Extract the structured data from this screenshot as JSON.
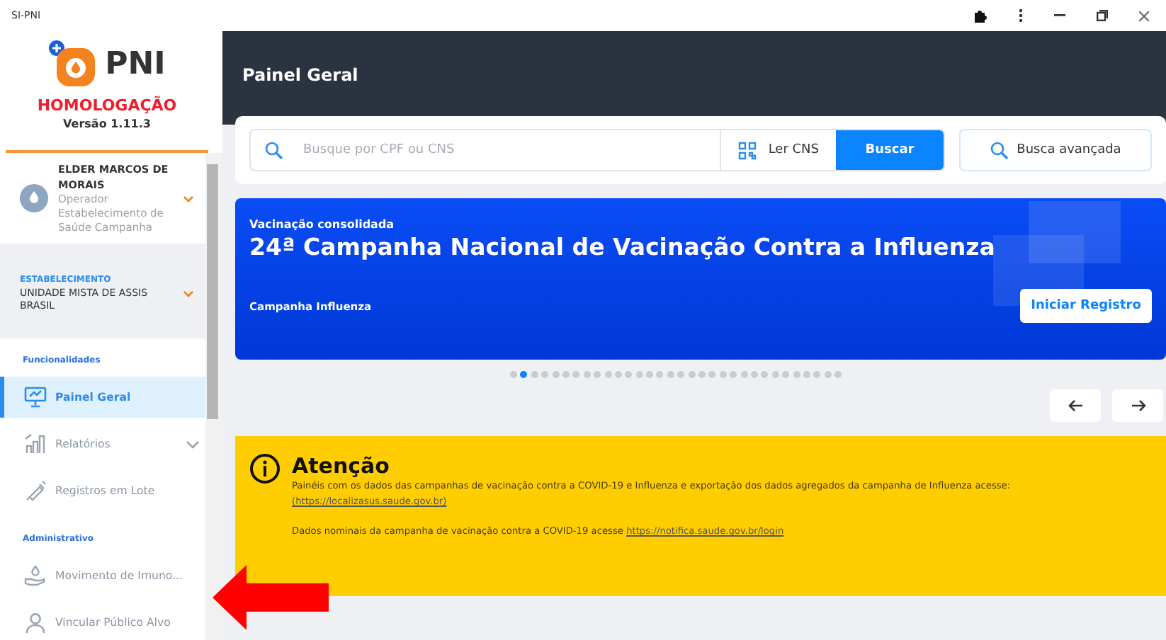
{
  "window": {
    "title": "SI-PNI"
  },
  "sidebar": {
    "logo_text": "PNI",
    "environment": "HOMOLOGAÇÃO",
    "version": "Versão 1.11.3",
    "user": {
      "name": "ELDER MARCOS DE MORAIS",
      "role": "Operador Estabelecimento de Saúde Campanha"
    },
    "establishment": {
      "label": "ESTABELECIMENTO",
      "value": "UNIDADE MISTA DE ASSIS BRASIL"
    },
    "sections": [
      {
        "title": "Funcionalidades",
        "items": [
          {
            "label": "Painel Geral",
            "kind": "panel",
            "selected": true,
            "expandable": false
          },
          {
            "label": "Relatórios",
            "kind": "chart",
            "selected": false,
            "expandable": true
          },
          {
            "label": "Registros em Lote",
            "kind": "syringe",
            "selected": false,
            "expandable": false
          }
        ]
      },
      {
        "title": "Administrativo",
        "items": [
          {
            "label": "Movimento de Imuno...",
            "kind": "hand",
            "selected": false,
            "expandable": false
          },
          {
            "label": "Vincular Público Alvo",
            "kind": "person",
            "selected": false,
            "expandable": false
          }
        ]
      }
    ]
  },
  "header": {
    "title": "Painel Geral"
  },
  "search": {
    "placeholder": "Busque por CPF ou CNS",
    "scan_button": "Ler CNS",
    "search_button": "Buscar",
    "advanced_button": "Busca avançada"
  },
  "banner": {
    "eyebrow": "Vacinação consolidada",
    "title": "24ª Campanha Nacional de Vacinação Contra a Influenza",
    "subtitle": "Campanha Influenza",
    "button": "Iniciar Registro"
  },
  "carousel_dots": [
    {
      "selected": false
    },
    {
      "selected": true
    },
    {
      "selected": false
    },
    {
      "selected": false
    },
    {
      "selected": false
    },
    {
      "selected": false
    },
    {
      "selected": false
    },
    {
      "selected": false
    },
    {
      "selected": false
    },
    {
      "selected": false
    },
    {
      "selected": false
    },
    {
      "selected": false
    },
    {
      "selected": false
    },
    {
      "selected": false
    },
    {
      "selected": false
    },
    {
      "selected": false
    },
    {
      "selected": false
    },
    {
      "selected": false
    },
    {
      "selected": false
    },
    {
      "selected": false
    },
    {
      "selected": false
    },
    {
      "selected": false
    },
    {
      "selected": false
    },
    {
      "selected": false
    },
    {
      "selected": false
    },
    {
      "selected": false
    },
    {
      "selected": false
    },
    {
      "selected": false
    },
    {
      "selected": false
    },
    {
      "selected": false
    },
    {
      "selected": false
    },
    {
      "selected": false
    }
  ],
  "alert": {
    "title": "Atenção",
    "line_1": "Painéis com os dados das campanhas de vacinação contra a COVID-19 e Influenza e exportação dos dados agregados da campanha de Influenza acesse:",
    "link_1": "(https://localizasus.saude.gov.br)",
    "line_2": "Dados nominais da campanha de vacinação contra a COVID-19 acesse",
    "link_2": "https://notifica.saude.gov.br/login"
  }
}
